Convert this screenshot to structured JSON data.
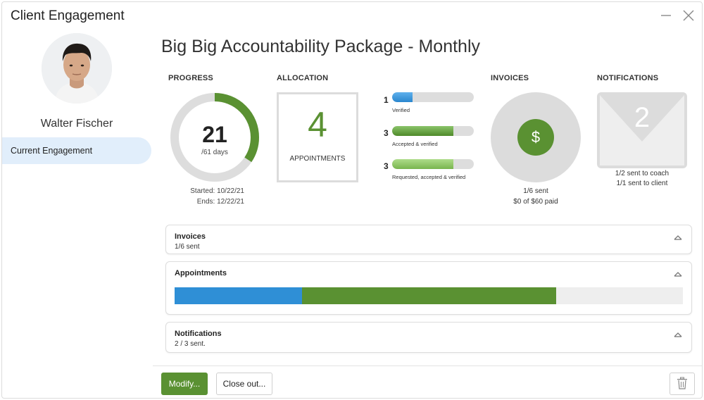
{
  "window": {
    "title": "Client Engagement",
    "minimize_icon": "minimize-icon",
    "close_icon": "close-icon"
  },
  "sidebar": {
    "client_name": "Walter Fischer",
    "avatar_icon": "avatar",
    "nav": [
      {
        "label": "Current Engagement",
        "selected": true
      }
    ]
  },
  "main": {
    "title": "Big Big Accountability Package - Monthly",
    "progress": {
      "label": "PROGRESS",
      "days_elapsed": "21",
      "days_total_label": "/61 days",
      "fraction": 0.344,
      "started": "Started: 10/22/21",
      "ends": "Ends: 12/22/21"
    },
    "allocation": {
      "label": "ALLOCATION",
      "count": "4",
      "unit": "APPOINTMENTS",
      "bars": [
        {
          "count": "1",
          "caption": "Verified",
          "fraction": 0.25
        },
        {
          "count": "3",
          "caption": "Accepted & verified",
          "fraction": 0.75
        },
        {
          "count": "3",
          "caption": "Requested, accepted & verified",
          "fraction": 0.75
        }
      ]
    },
    "invoices": {
      "label": "INVOICES",
      "icon": "dollar-icon",
      "sent": "1/6 sent",
      "paid": "$0 of $60 paid"
    },
    "notifications": {
      "label": "NOTIFICATIONS",
      "icon": "envelope-icon",
      "count": "2",
      "coach": "1/2 sent to coach",
      "client": "1/1 sent to client"
    },
    "panels": {
      "invoices": {
        "title": "Invoices",
        "subtitle": "1/6 sent"
      },
      "appointments": {
        "title": "Appointments",
        "verified_fraction": 0.25,
        "accepted_fraction": 0.5
      },
      "notifications": {
        "title": "Notifications",
        "subtitle": "2 / 3 sent."
      }
    },
    "footer": {
      "modify_label": "Modify...",
      "close_out_label": "Close out...",
      "trash_icon": "trash-icon"
    }
  },
  "colors": {
    "accent_green": "#5a9132",
    "accent_blue": "#2f8fd6",
    "track_gray": "#dddddd"
  }
}
